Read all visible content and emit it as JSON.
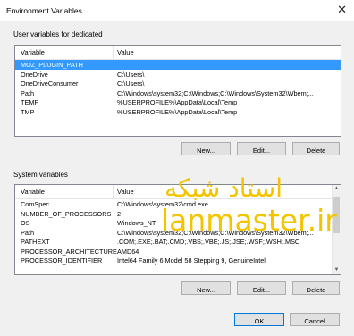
{
  "window": {
    "title": "Environment Variables"
  },
  "user_section": {
    "label": "User variables for dedicated",
    "columns": [
      "Variable",
      "Value"
    ],
    "rows": [
      {
        "variable": "MOZ_PLUGIN_PATH",
        "value": ""
      },
      {
        "variable": "OneDrive",
        "value": "C:\\Users\\"
      },
      {
        "variable": "OneDriveConsumer",
        "value": "C:\\Users\\"
      },
      {
        "variable": "Path",
        "value": "C:\\Windows\\system32;C:\\Windows;C:\\Windows\\System32\\Wbem;..."
      },
      {
        "variable": "TEMP",
        "value": "%USERPROFILE%\\AppData\\Local\\Temp"
      },
      {
        "variable": "TMP",
        "value": "%USERPROFILE%\\AppData\\Local\\Temp"
      }
    ],
    "buttons": {
      "new": "New...",
      "edit": "Edit...",
      "delete": "Delete"
    }
  },
  "system_section": {
    "label": "System variables",
    "columns": [
      "Variable",
      "Value"
    ],
    "rows": [
      {
        "variable": "ComSpec",
        "value": "C:\\Windows\\system32\\cmd.exe"
      },
      {
        "variable": "NUMBER_OF_PROCESSORS",
        "value": "2"
      },
      {
        "variable": "OS",
        "value": "Windows_NT"
      },
      {
        "variable": "Path",
        "value": "C:\\Windows\\system32;C:\\Windows;C:\\Windows\\System32\\Wbem;..."
      },
      {
        "variable": "PATHEXT",
        "value": ".COM;.EXE;.BAT;.CMD;.VBS;.VBE;.JS;.JSE;.WSF;.WSH;.MSC"
      },
      {
        "variable": "PROCESSOR_ARCHITECTURE",
        "value": "AMD64"
      },
      {
        "variable": "PROCESSOR_IDENTIFIER",
        "value": "Intel64 Family 6 Model 58 Stepping 9, GenuineIntel"
      }
    ],
    "buttons": {
      "new": "New...",
      "edit": "Edit...",
      "delete": "Delete"
    }
  },
  "footer": {
    "ok": "OK",
    "cancel": "Cancel"
  },
  "watermark": {
    "persian": "استاد شبکه",
    "english": "lanmaster.ir"
  },
  "icons": {
    "close": "close-icon",
    "scroll_up": "scroll-up-arrow-icon",
    "scroll_down": "scroll-down-arrow-icon"
  },
  "colors": {
    "selection": "#3399ff",
    "watermark": "#f3c400",
    "default_button_border": "#0078d7"
  }
}
